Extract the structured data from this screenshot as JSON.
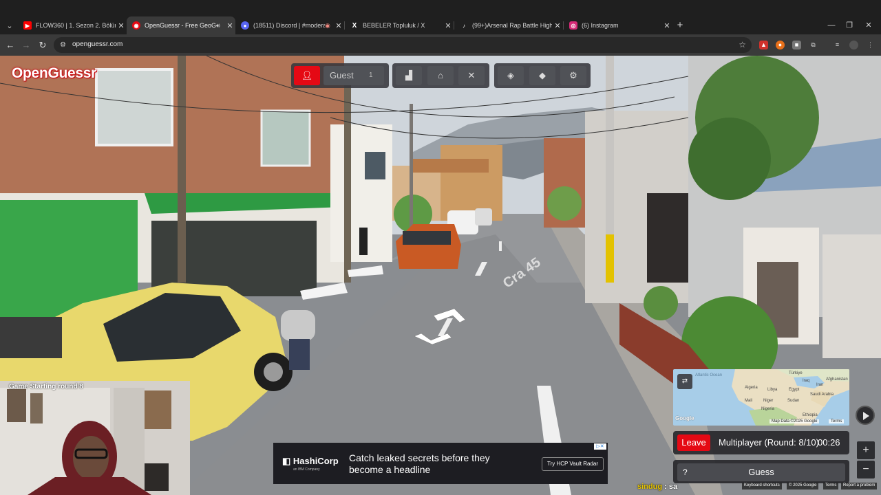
{
  "browser": {
    "tabs": [
      {
        "title": "FLOW360 | 1. Sezon 2. Bölüm -",
        "favicon_color": "#ff0000",
        "favicon": "▶",
        "active": false
      },
      {
        "title": "OpenGuessr - Free GeoGue",
        "favicon_color": "#e50914",
        "favicon": "◉",
        "active": true,
        "audio": true
      },
      {
        "title": "(18511) Discord | #moderat",
        "favicon_color": "#5865f2",
        "favicon": "●",
        "active": false,
        "recording": true
      },
      {
        "title": "BEBELER Topluluk / X",
        "favicon_color": "#000000",
        "favicon": "X",
        "active": false
      },
      {
        "title": "(99+)Arsenal Rap Battle Highlig",
        "favicon_color": "#111111",
        "favicon": "♪",
        "active": false
      },
      {
        "title": "(6) Instagram",
        "favicon_color": "#d62976",
        "favicon": "◎",
        "active": false
      }
    ],
    "url": "openguessr.com",
    "icons": {
      "back": "arrow-left-icon",
      "forward": "arrow-right-icon",
      "reload": "reload-icon",
      "bookmark": "star-icon"
    }
  },
  "game": {
    "logo": "OpenGuessr",
    "player_name": "Guest",
    "player_count": "1",
    "status": {
      "leave_label": "Leave",
      "mode": "Multiplayer (Round: 8/10)",
      "timer": "00:26"
    },
    "guess_label": "Guess",
    "help_label": "?",
    "zoom_in": "+",
    "zoom_out": "−",
    "street_sign": "Cra 45"
  },
  "map": {
    "labels": [
      "Türkiye",
      "Afghanistan",
      "Iran",
      "Iraq",
      "Algeria",
      "Libya",
      "Egypt",
      "Saudi Arabia",
      "Mali",
      "Niger",
      "Sudan",
      "Nigeria",
      "Ethiopia",
      "Atlantic Ocean"
    ],
    "attribution": "Map Data ©2025 Google",
    "terms": "Terms",
    "google": "Google"
  },
  "footer": {
    "shortcuts": "Keyboard shortcuts",
    "copyright": "© 2025 Google",
    "terms": "Terms",
    "report": "Report a problem"
  },
  "ad": {
    "brand": "HashiCorp",
    "brand_sub": "an IBM Company",
    "message": "Catch leaked secrets before they become a headline",
    "cta": "Try HCP Vault Radar"
  },
  "stream": {
    "cam_caption": "Game Starting round 8",
    "chat_user": "sindug",
    "chat_msg": ": sa"
  },
  "colors": {
    "accent": "#e50914",
    "panel": "#28282c"
  }
}
